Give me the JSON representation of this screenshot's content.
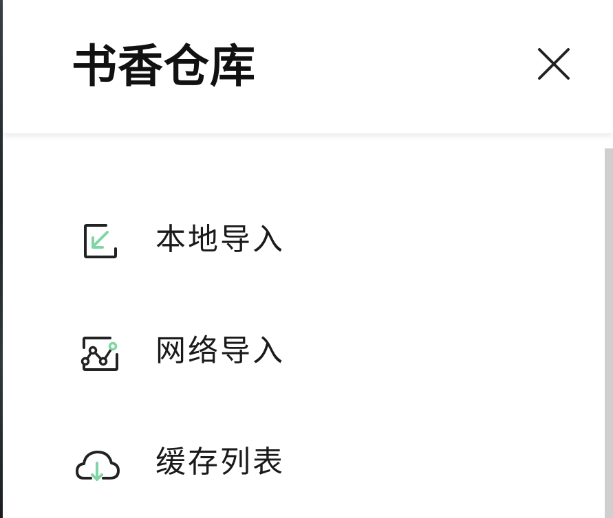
{
  "drawer": {
    "title": "书香仓库"
  },
  "colors": {
    "accent": "#7fd6a4",
    "icon_stroke": "#222222",
    "text": "#1a1a1a",
    "scrollbar": "#cfcfcf"
  },
  "menu": {
    "items": [
      {
        "label": "本地导入",
        "icon": "local-import-icon"
      },
      {
        "label": "网络导入",
        "icon": "network-import-icon"
      },
      {
        "label": "缓存列表",
        "icon": "cloud-download-icon"
      }
    ]
  }
}
